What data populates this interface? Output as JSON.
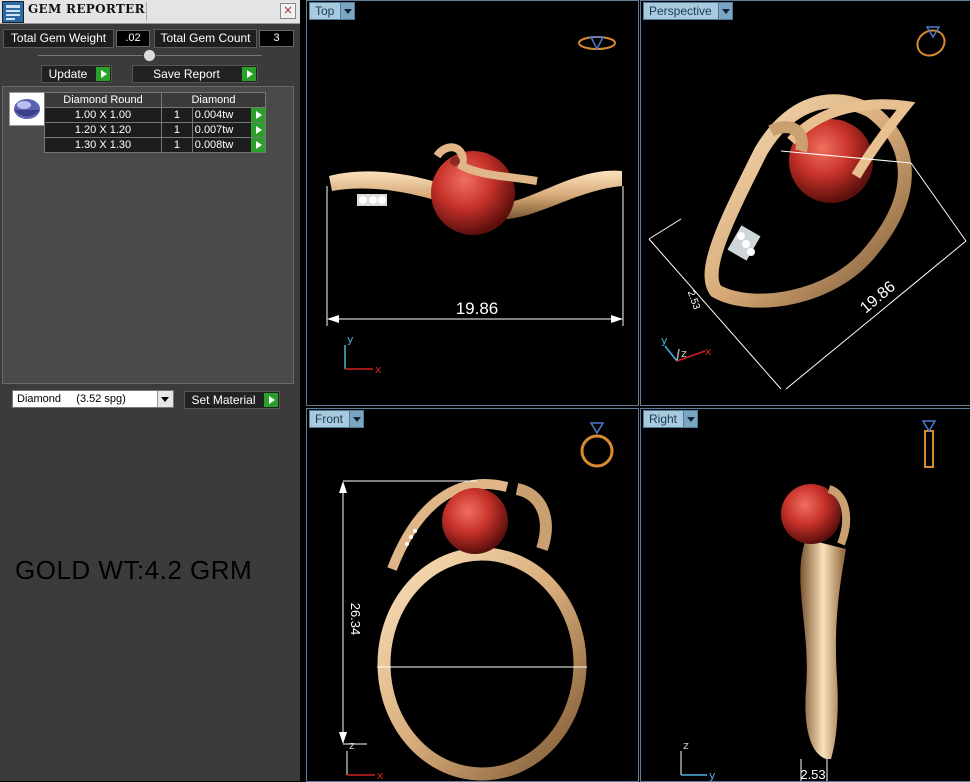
{
  "panel": {
    "title": "GEM REPORTER",
    "close_glyph": "×",
    "total_gem_weight_label": "Total Gem Weight",
    "total_gem_weight_value": ".02",
    "total_gem_count_label": "Total Gem Count",
    "total_gem_count_value": "3",
    "update_label": "Update",
    "save_report_label": "Save Report",
    "table": {
      "col_shape": "Diamond Round",
      "col_type": "Diamond",
      "rows": [
        {
          "size": "1.00 X 1.00",
          "qty": "1",
          "weight": "0.004tw"
        },
        {
          "size": "1.20 X 1.20",
          "qty": "1",
          "weight": "0.007tw"
        },
        {
          "size": "1.30 X 1.30",
          "qty": "1",
          "weight": "0.008tw"
        }
      ]
    },
    "material_select": "Diamond     (3.52 spg)",
    "set_material_label": "Set Material",
    "gold_weight_note": "GOLD WT:4.2 GRM"
  },
  "viewports": {
    "top": {
      "label": "Top",
      "dimension": "19.86"
    },
    "perspective": {
      "label": "Perspective",
      "dimension_a": "19.86",
      "dimension_b": "2.53"
    },
    "front": {
      "label": "Front",
      "dimension": "26.34"
    },
    "right": {
      "label": "Right",
      "dimension": "2.53"
    }
  },
  "axes": {
    "x": "x",
    "y": "y",
    "z": "z"
  },
  "colors": {
    "gold": "#d8ac7a",
    "coral": "#c8322a",
    "viewport_tab": "#a9c9de",
    "action_green": "#2aa02a",
    "axis_red": "#d02020",
    "axis_blue": "#4ab0d8"
  },
  "icons": [
    "gem-reporter-app-icon",
    "close-icon",
    "play-arrow-icon",
    "gem-thumbnail-icon",
    "dropdown-icon",
    "ring-nav-cube-icon"
  ]
}
